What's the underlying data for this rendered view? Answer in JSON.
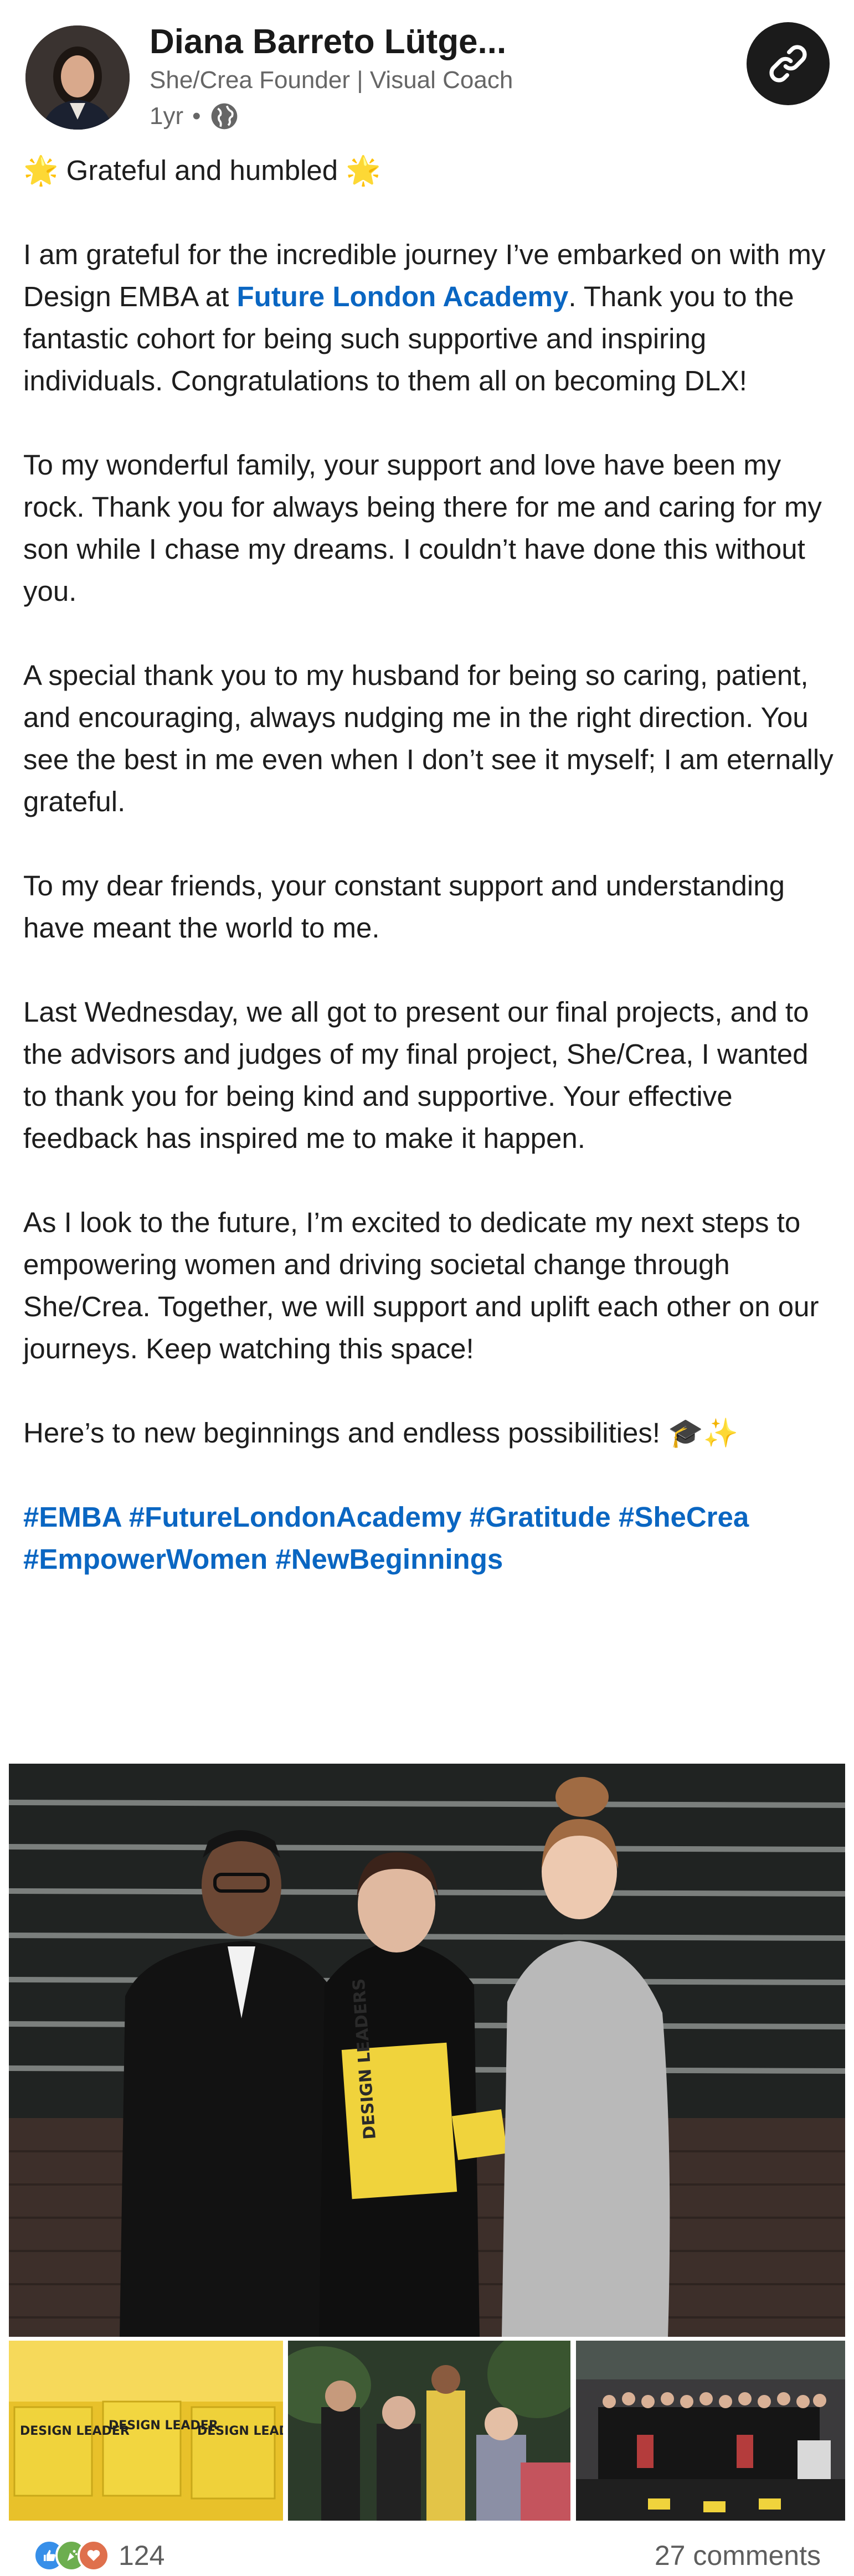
{
  "post": {
    "author": {
      "name": "Diana Barreto Lütge...",
      "headline": "She/Crea Founder | Visual Coach",
      "time": "1yr",
      "visibility_icon": "globe-icon"
    },
    "copy_link_icon": "link-icon",
    "text": {
      "p1": "🌟 Grateful and humbled 🌟",
      "p2_before": "I am grateful for the incredible journey I’ve embarked on with my Design EMBA at ",
      "p2_link": "Future London Academy",
      "p2_after": ". Thank you to the fantastic cohort for being such supportive and inspiring individuals. Congratulations to them all on becoming DLX!",
      "p3": "To my wonderful family, your support and love have been my rock. Thank you for always being there for me and caring for my son while I chase my dreams. I couldn’t have done this without you.",
      "p4": "A special thank you to my husband for being so caring, patient, and encouraging, always nudging me in the right direction. You see the best in me even when I don’t see it myself; I am eternally grateful.",
      "p5": "To my dear friends, your constant support and understanding have meant the world to me.",
      "p6": "Last Wednesday, we all got to present our final projects, and to the advisors and judges of my final project, She/Crea, I wanted to thank you for being kind and supportive. Your effective feedback has inspired me to make it happen.",
      "p7": "As I look to the future, I’m excited to dedicate my next steps to empowering women and driving societal change through She/Crea. Together, we will support and uplift each other on our journeys. Keep watching this space!",
      "p8": "Here’s to new beginnings and endless possibilities! 🎓✨"
    },
    "hashtags": [
      "#EMBA",
      "#FutureLondonAcademy",
      "#Gratitude",
      "#SheCrea",
      "#EmpowerWomen",
      "#NewBeginnings"
    ],
    "images": {
      "main_alt": "Three people at an award ceremony, woman in center holding a Design Leaders book and yellow award",
      "thumb1_alt": "Yellow Design Leader award cubes",
      "thumb2_alt": "Guests mingling at an event",
      "thumb3_alt": "Group photo of graduating cohort on stage",
      "main_award_text": "DESIGN LEADERS",
      "cube_text": "DESIGN LEADER"
    },
    "reactions": {
      "icons": [
        "like-reaction-icon",
        "celebrate-reaction-icon",
        "love-reaction-icon"
      ],
      "count": "124",
      "comments": "27 comments"
    },
    "colors": {
      "link": "#0a66c2",
      "like": "#378fe9",
      "celebrate": "#6dae4f",
      "love": "#df704d",
      "award_yellow": "#f2d43a"
    }
  }
}
